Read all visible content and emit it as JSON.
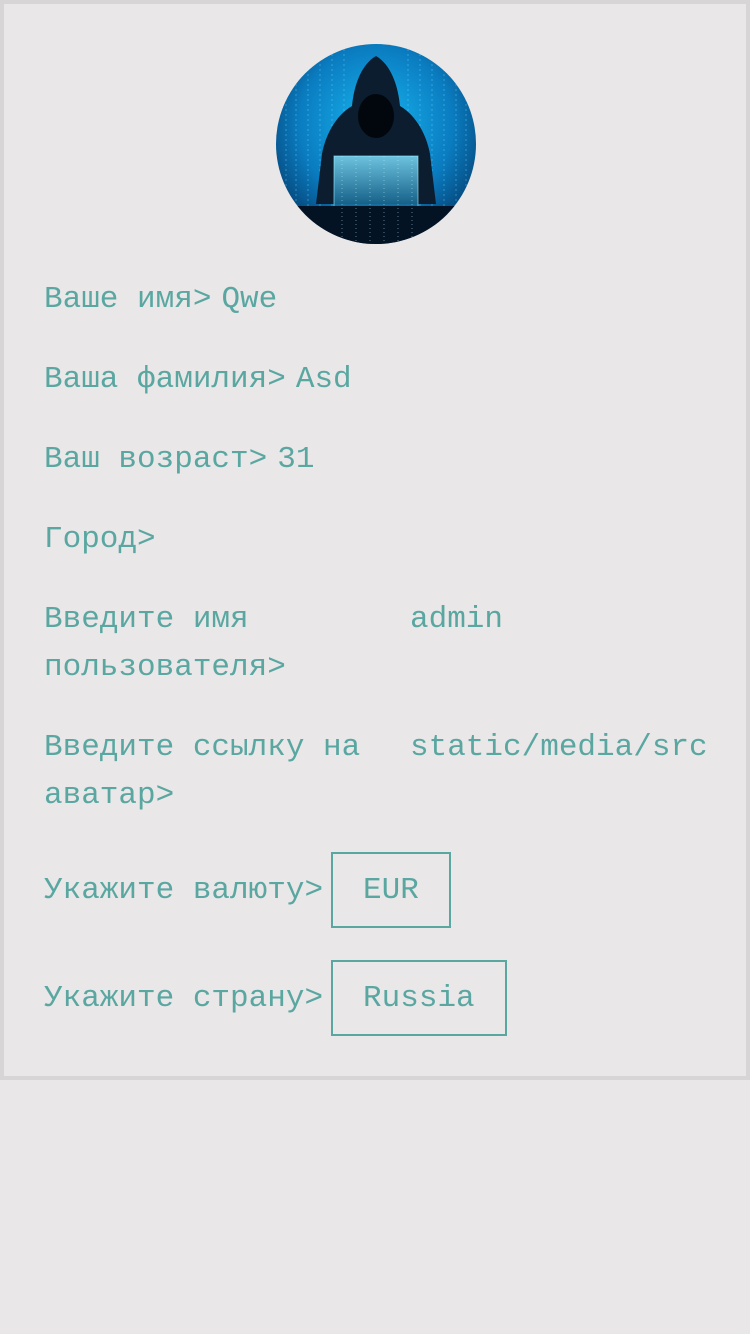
{
  "profile": {
    "avatar_alt": "hooded-hacker-avatar",
    "fields": {
      "first_name_label": "Ваше имя>",
      "first_name_value": "Qwe",
      "last_name_label": "Ваша фамилия>",
      "last_name_value": "Asd",
      "age_label": "Ваш возраст>",
      "age_value": "31",
      "city_label": "Город>",
      "city_value": "",
      "username_label": "Введите имя пользователя>",
      "username_value": "admin",
      "avatar_link_label": "Введите ссылку на аватар>",
      "avatar_link_value": "static/media/src",
      "currency_label": "Укажите валюту>",
      "currency_value": "EUR",
      "country_label": "Укажите страну>",
      "country_value": "Russia"
    }
  },
  "colors": {
    "text": "#5aa7a2",
    "background": "#e9e7e7",
    "card_border": "#d8d5d6",
    "avatar_blue": "#0a8fd0"
  }
}
